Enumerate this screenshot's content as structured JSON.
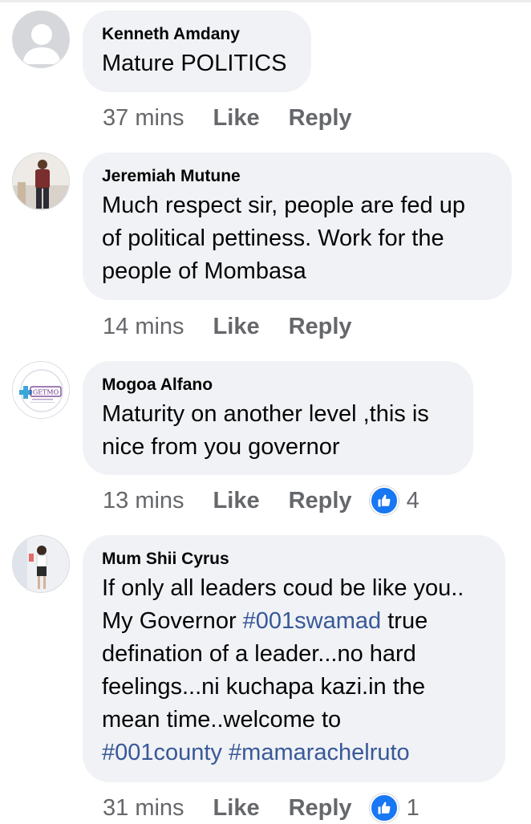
{
  "comments": [
    {
      "author": "Kenneth Amdany",
      "lines": [
        "Mature POLITICS"
      ],
      "time": "37 mins",
      "like": "Like",
      "reply": "Reply"
    },
    {
      "author": "Jeremiah Mutune",
      "lines": [
        "Much respect sir, people are fed up",
        "of political pettiness. Work for the",
        "people of Mombasa"
      ],
      "time": "14 mins",
      "like": "Like",
      "reply": "Reply"
    },
    {
      "author": "Mogoa Alfano",
      "avatar_logo_text": "GETMO",
      "lines": [
        "Maturity on another level ,this is",
        "nice from you governor"
      ],
      "time": "13 mins",
      "like": "Like",
      "reply": "Reply",
      "reaction_count": "4"
    },
    {
      "author": "Mum Shii Cyrus",
      "line1": "If only all leaders coud be like you..",
      "line2_prefix": "My Governor ",
      "hashtag1": "#001swamad",
      "line2_suffix": " true",
      "line3": "defination of a leader...no hard",
      "line4": "feelings...ni kuchapa kazi.in the",
      "line5": "mean time..welcome to",
      "hashtag2": "#001county",
      "hashtag3": "#mamarachelruto",
      "time": "31 mins",
      "like": "Like",
      "reply": "Reply",
      "reaction_count": "1"
    }
  ],
  "colors": {
    "bubble": "#f0f2f5",
    "meta_text": "#65676b",
    "hashtag": "#385898",
    "reaction_blue": "#1877f2"
  },
  "icons": {
    "reaction": "thumbs-up-icon",
    "default_avatar": "default-avatar-icon"
  }
}
